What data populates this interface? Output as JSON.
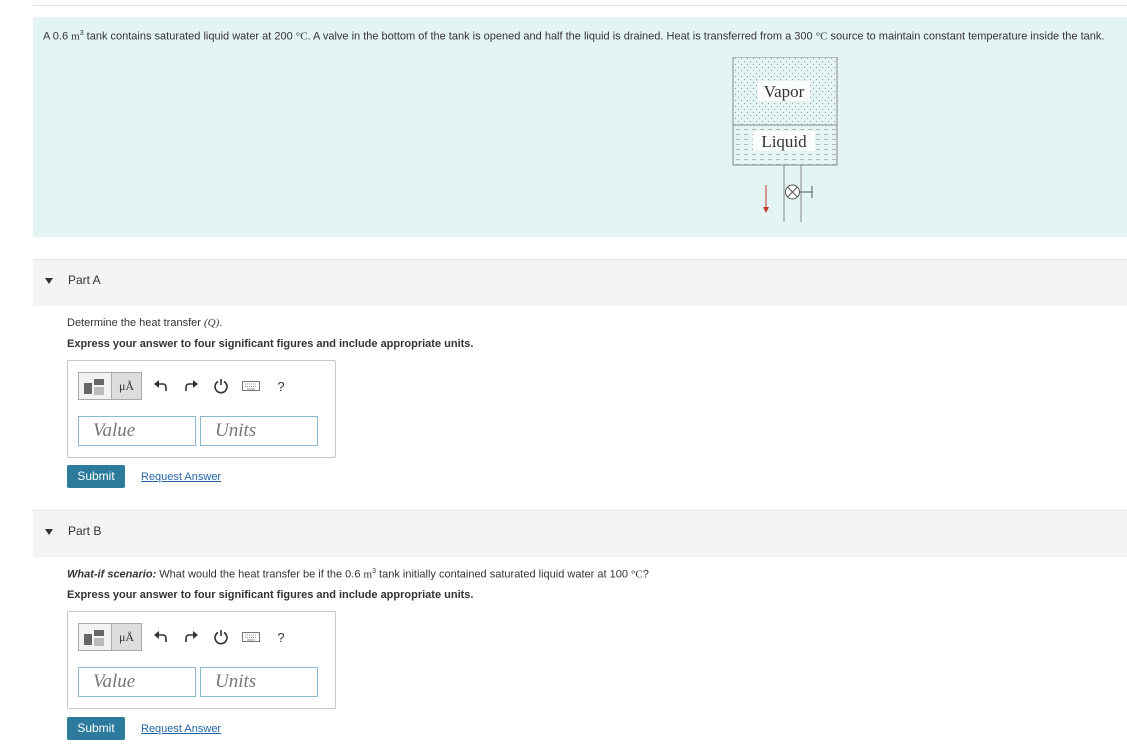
{
  "problem": {
    "text_before": "A 0.6 ",
    "volume_unit": "m",
    "volume_exp": "3",
    "text_mid": " tank contains saturated liquid water at 200 ",
    "temp_unit_1": "°C",
    "text_mid2": ". A valve in the bottom of the tank is opened and half the liquid is drained. Heat is transferred from a 300 ",
    "temp_unit_2": "°C",
    "text_after": " source to maintain constant temperature inside the tank.",
    "figure": {
      "vapor_label": "Vapor",
      "liquid_label": "Liquid"
    }
  },
  "parts": [
    {
      "title": "Part A",
      "question_prefix": "Determine the heat transfer ",
      "question_var": "(Q)",
      "question_suffix": ".",
      "instruction": "Express your answer to four significant figures and include appropriate units.",
      "units_button": "μÅ",
      "value_placeholder": "Value",
      "units_placeholder": "Units",
      "help": "?",
      "submit_label": "Submit",
      "request_label": "Request Answer"
    },
    {
      "title": "Part B",
      "question_scenario": "What-if scenario:",
      "question_prefix": " What would the heat transfer be if the 0.6 ",
      "question_unit": "m",
      "question_exp": "3",
      "question_mid": " tank initially contained saturated liquid water at 100 ",
      "question_temp_unit": "°C",
      "question_suffix": "?",
      "instruction": "Express your answer to four significant figures and include appropriate units.",
      "units_button": "μÅ",
      "value_placeholder": "Value",
      "units_placeholder": "Units",
      "help": "?",
      "submit_label": "Submit",
      "request_label": "Request Answer"
    }
  ]
}
